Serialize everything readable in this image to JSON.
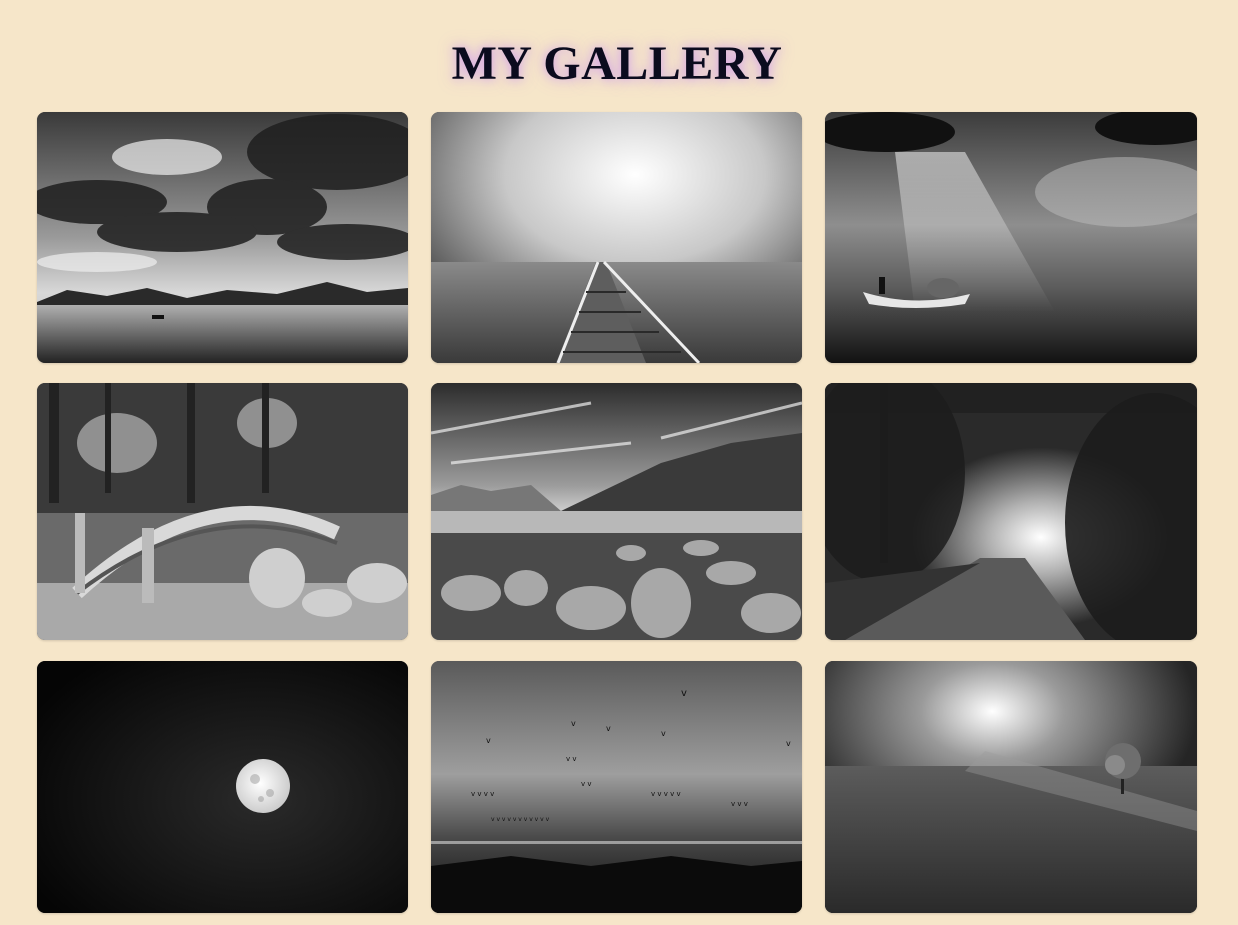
{
  "gallery": {
    "title": "MY GALLERY"
  }
}
